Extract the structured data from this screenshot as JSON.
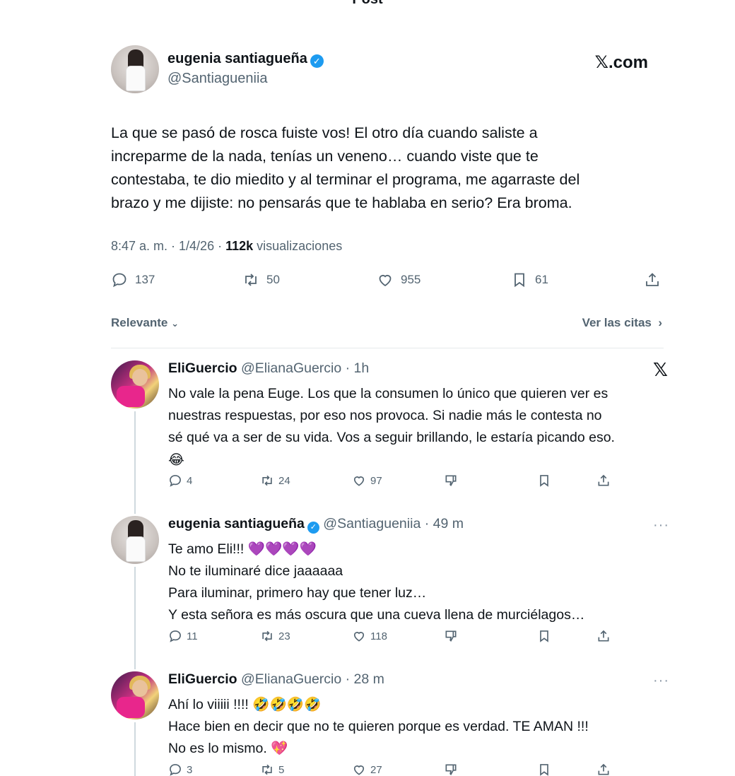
{
  "page_title": "Post",
  "source_label": "𝕏.com",
  "post": {
    "author_name": "eugenia santiagueña",
    "author_handle": "@Santiagueniia",
    "text_lines": [
      "La que se pasó de rosca fuiste vos! El otro día cuando saliste a",
      "increparme de la nada, tenías un veneno… cuando viste que te",
      "contestaba, te dio miedito y al terminar el programa, me agarraste del",
      "brazo y me dijiste: no pensarás que te hablaba en serio? Era broma."
    ],
    "time": "8:47 a. m. · 1/4/26 · ",
    "views_count": "112k",
    "views_label": " visualizaciones",
    "replies": "137",
    "reposts": "50",
    "likes": "955",
    "bookmarks": "61"
  },
  "sort_label": "Relevante",
  "quotes_label": "Ver las citas",
  "replies": [
    {
      "name": "EliGuercio",
      "handle_time": " @ElianaGuercio · 1h",
      "body_lines": [
        "No vale la pena Euge. Los que la consumen lo único que quieren ver es",
        "nuestras respuestas, por eso nos provoca. Si nadie más le contesta no",
        "sé qué va a ser de su vida. Vos a seguir brillando, le estaría picando eso.",
        "😂"
      ],
      "replies": "4",
      "reposts": "24",
      "likes": "97"
    },
    {
      "name": "eugenia santiagueña",
      "handle_time": " @Santiagueniia · 49 m",
      "body_lines": [
        "Te amo Eli!!! 💜💜💜💜",
        "No te iluminaré dice jaaaaaa",
        "Para iluminar, primero hay que tener luz…",
        "Y esta señora es más oscura que una cueva llena de murciélagos…"
      ],
      "replies": "11",
      "reposts": "23",
      "likes": "118"
    },
    {
      "name": "EliGuercio",
      "handle_time": " @ElianaGuercio · 28 m",
      "body_lines": [
        "Ahí lo viiiii !!!! 🤣🤣🤣🤣",
        "Hace bien en decir que no te quieren porque es verdad. TE AMAN !!!",
        "No es lo mismo. 💖"
      ],
      "replies": "3",
      "reposts": "5",
      "likes": "27"
    }
  ],
  "icons": [
    "reply-icon",
    "repost-icon",
    "like-icon",
    "bookmark-icon",
    "share-icon",
    "dislike-icon",
    "verified-icon",
    "more-icon",
    "x-logo-icon"
  ],
  "colors": {
    "verified": "#1d9bf0",
    "secondary_text": "#536471",
    "divider": "#e6e9eb"
  }
}
